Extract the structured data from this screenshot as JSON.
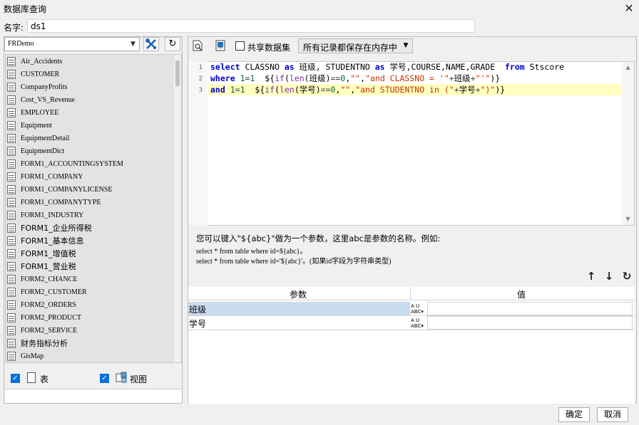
{
  "window": {
    "title": "数据库查询",
    "close_glyph": "✕"
  },
  "name_row": {
    "label": "名字:",
    "value": "ds1"
  },
  "left": {
    "datasource": "FRDemo",
    "tables": [
      "Air_Accidents",
      "CUSTOMER",
      "CompanyProfits",
      "Cost_VS_Revenue",
      "EMPLOYEE",
      "Equipment",
      "EquipmentDetail",
      "EquipmentDict",
      "FORM1_ACCOUNTINGSYSTEM",
      "FORM1_COMPANY",
      "FORM1_COMPANYLICENSE",
      "FORM1_COMPANYTYPE",
      "FORM1_INDUSTRY",
      "FORM1_企业所得税",
      "FORM1_基本信息",
      "FORM1_增值税",
      "FORM1_营业税",
      "FORM2_CHANCE",
      "FORM2_CUSTOMER",
      "FORM2_ORDERS",
      "FORM2_PRODUCT",
      "FORM2_SERVICE",
      "财务指标分析",
      "GisMap"
    ],
    "filters": {
      "table_label": "表",
      "view_label": "视图",
      "table_checked": true,
      "view_checked": true
    }
  },
  "right": {
    "share_label": "共享数据集",
    "mode_value": "所有记录都保存在内存中",
    "editor": {
      "line_numbers": [
        "1",
        "2",
        "3"
      ]
    },
    "help": {
      "line1": "您可以键入\"${abc}\"做为一个参数，这里abc是参数的名称。例如:",
      "line2": "select * from table where id=${abc}。",
      "line3": "select * from table where id='${abc}'。(如果id字段为字符串类型)"
    },
    "params": {
      "header_param": "参数",
      "header_value": "值",
      "rows": [
        {
          "name": "班级",
          "type_icon": "abc-type-icon",
          "value": ""
        },
        {
          "name": "学号",
          "type_icon": "abc-type-icon",
          "value": ""
        }
      ]
    }
  },
  "footer": {
    "ok": "确定",
    "cancel": "取消"
  },
  "colors": {
    "keyword": "#0000cc",
    "string": "#cc3300",
    "function": "#7a2fa8",
    "active_line": "#ffffc0",
    "selected_row": "#c8dcee",
    "checkbox": "#0a6fd8"
  }
}
